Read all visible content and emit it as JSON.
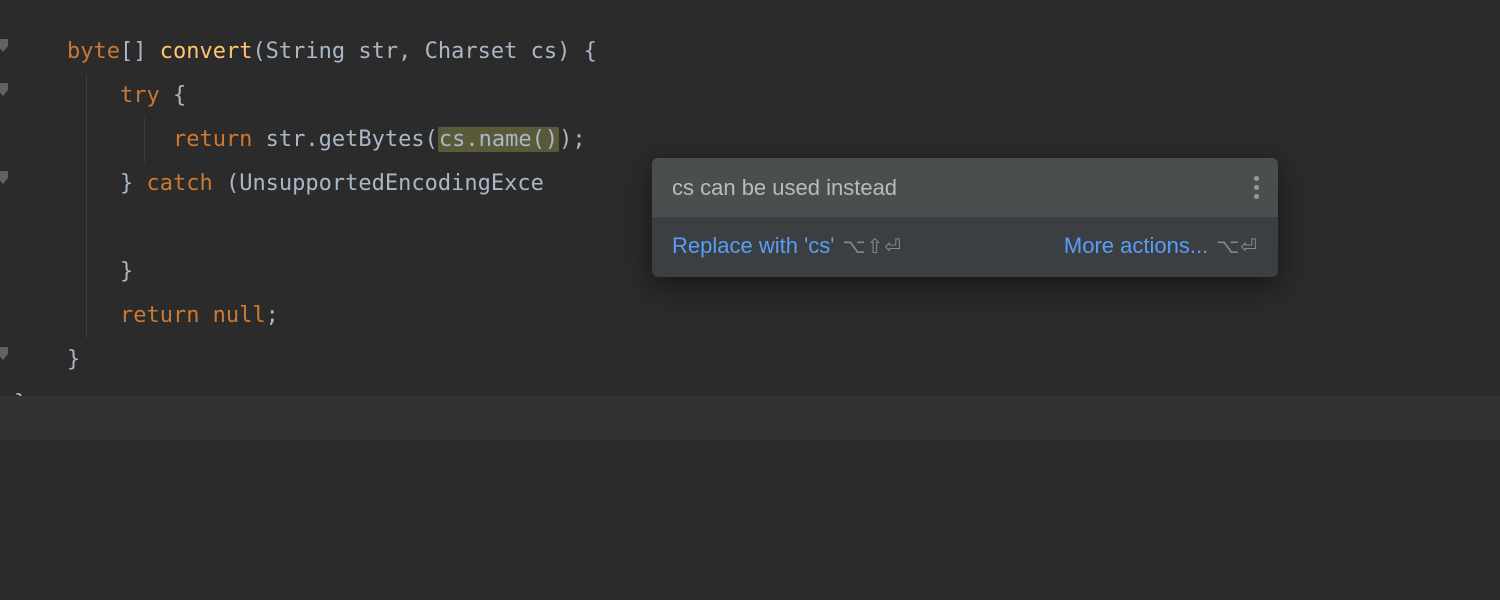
{
  "code": {
    "line1": {
      "byte": "byte",
      "brackets": "[] ",
      "method": "convert",
      "params": "(String str, Charset cs) {"
    },
    "line2": {
      "try": "try",
      "brace": " {"
    },
    "line3": {
      "ret": "return",
      "prefix": " str.getBytes(",
      "highlighted": "cs.name()",
      "suffix": ");"
    },
    "line4": {
      "closeBrace": "} ",
      "catch": "catch",
      "exc": " (UnsupportedEncodingExce"
    },
    "line5": "",
    "line6": "    }",
    "line7": {
      "ret": "return null",
      "semi": ";"
    },
    "line8": "  }",
    "line9": "}"
  },
  "popup": {
    "title": "cs can be used instead",
    "action1": "Replace with 'cs'",
    "shortcut1": "⌥⇧⏎",
    "action2": "More actions...",
    "shortcut2": "⌥⏎"
  }
}
